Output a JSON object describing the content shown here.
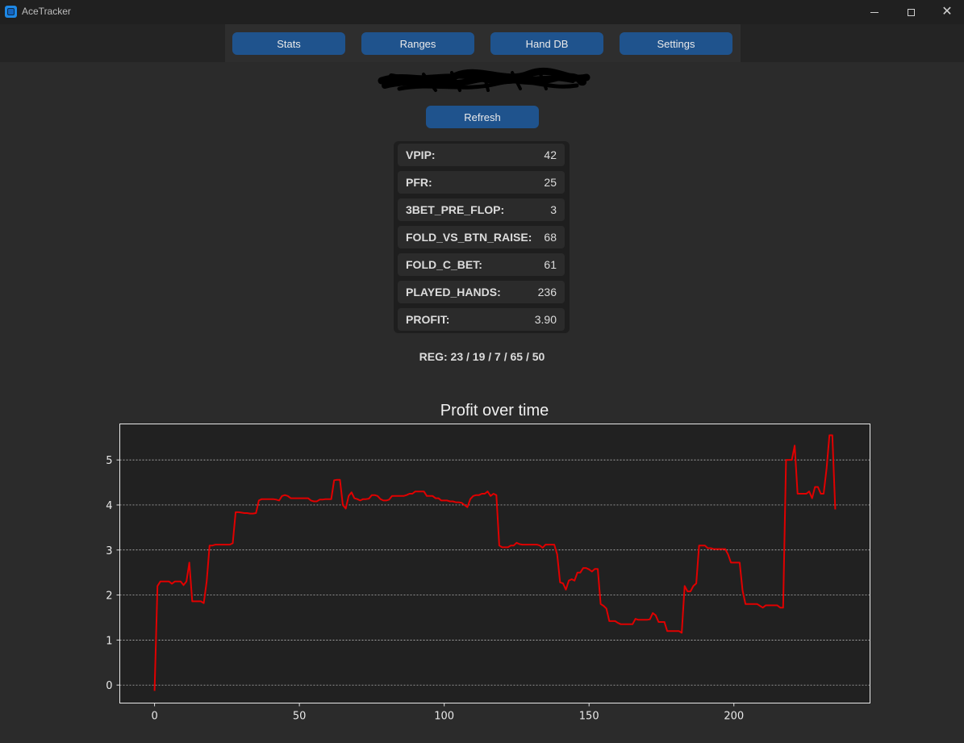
{
  "window": {
    "title": "AceTracker",
    "controls": {
      "minimize": "minimize-icon",
      "maximize": "maximize-icon",
      "close": "close-icon"
    }
  },
  "nav": {
    "buttons": [
      "Stats",
      "Ranges",
      "Hand DB",
      "Settings"
    ]
  },
  "refresh_label": "Refresh",
  "stats": [
    {
      "label": "VPIP:",
      "value": "42"
    },
    {
      "label": "PFR:",
      "value": "25"
    },
    {
      "label": "3BET_PRE_FLOP:",
      "value": "3"
    },
    {
      "label": "FOLD_VS_BTN_RAISE:",
      "value": "68"
    },
    {
      "label": "FOLD_C_BET:",
      "value": "61"
    },
    {
      "label": "PLAYED_HANDS:",
      "value": "236"
    },
    {
      "label": "PROFIT:",
      "value": "3.90"
    }
  ],
  "reg_line": "REG: 23 / 19 / 7 / 65 / 50",
  "colors": {
    "accent_button": "#1f538d",
    "background": "#2b2b2b",
    "plot_background": "#212121",
    "line": "#e00000"
  },
  "chart_data": {
    "type": "line",
    "title": "Profit over time",
    "xlabel": "",
    "ylabel": "",
    "xlim": [
      -12,
      247
    ],
    "ylim": [
      -0.4,
      5.8
    ],
    "xticks": [
      0,
      50,
      100,
      150,
      200
    ],
    "yticks": [
      0,
      1,
      2,
      3,
      4,
      5
    ],
    "grid": "horizontal dashed",
    "series": [
      {
        "x": [
          0,
          1,
          2,
          3,
          4,
          5,
          6,
          7,
          8,
          9,
          10,
          11,
          12,
          13,
          14,
          15,
          16,
          17,
          18,
          19,
          20,
          21,
          22,
          23,
          24,
          25,
          26,
          27,
          28,
          29,
          30,
          31,
          32,
          33,
          34,
          35,
          36,
          37,
          38,
          39,
          40,
          41,
          42,
          43,
          44,
          45,
          46,
          47,
          48,
          49,
          50,
          51,
          52,
          53,
          54,
          55,
          56,
          57,
          58,
          59,
          60,
          61,
          62,
          63,
          64,
          65,
          66,
          67,
          68,
          69,
          70,
          71,
          72,
          73,
          74,
          75,
          76,
          77,
          78,
          79,
          80,
          81,
          82,
          83,
          84,
          85,
          86,
          87,
          88,
          89,
          90,
          91,
          92,
          93,
          94,
          95,
          96,
          97,
          98,
          99,
          100,
          101,
          102,
          103,
          104,
          105,
          106,
          107,
          108,
          109,
          110,
          111,
          112,
          113,
          114,
          115,
          116,
          117,
          118,
          119,
          120,
          121,
          122,
          123,
          124,
          125,
          126,
          127,
          128,
          129,
          130,
          131,
          132,
          133,
          134,
          135,
          136,
          137,
          138,
          139,
          140,
          141,
          142,
          143,
          144,
          145,
          146,
          147,
          148,
          149,
          150,
          151,
          152,
          153,
          154,
          155,
          156,
          157,
          158,
          159,
          160,
          161,
          162,
          163,
          164,
          165,
          166,
          167,
          168,
          169,
          170,
          171,
          172,
          173,
          174,
          175,
          176,
          177,
          178,
          179,
          180,
          181,
          182,
          183,
          184,
          185,
          186,
          187,
          188,
          189,
          190,
          191,
          192,
          193,
          194,
          195,
          196,
          197,
          198,
          199,
          200,
          201,
          202,
          203,
          204,
          205,
          206,
          207,
          208,
          209,
          210,
          211,
          212,
          213,
          214,
          215,
          216,
          217,
          218,
          219,
          220,
          221,
          222,
          223,
          224,
          225,
          226,
          227,
          228,
          229,
          230,
          231,
          232,
          233,
          234,
          235
        ],
        "y": [
          -0.13,
          2.2,
          2.3,
          2.3,
          2.3,
          2.3,
          2.25,
          2.3,
          2.3,
          2.3,
          2.22,
          2.3,
          2.72,
          1.86,
          1.86,
          1.86,
          1.86,
          1.82,
          2.3,
          3.1,
          3.1,
          3.12,
          3.12,
          3.12,
          3.12,
          3.12,
          3.12,
          3.15,
          3.84,
          3.84,
          3.83,
          3.82,
          3.82,
          3.81,
          3.81,
          3.82,
          4.1,
          4.13,
          4.13,
          4.13,
          4.13,
          4.13,
          4.12,
          4.1,
          4.2,
          4.22,
          4.2,
          4.15,
          4.15,
          4.15,
          4.15,
          4.15,
          4.15,
          4.15,
          4.1,
          4.08,
          4.08,
          4.12,
          4.12,
          4.13,
          4.13,
          4.13,
          4.55,
          4.56,
          4.56,
          4.0,
          3.92,
          4.2,
          4.28,
          4.15,
          4.13,
          4.1,
          4.13,
          4.13,
          4.14,
          4.22,
          4.22,
          4.2,
          4.13,
          4.1,
          4.1,
          4.12,
          4.2,
          4.2,
          4.2,
          4.2,
          4.2,
          4.22,
          4.25,
          4.25,
          4.3,
          4.3,
          4.3,
          4.3,
          4.2,
          4.2,
          4.2,
          4.15,
          4.15,
          4.1,
          4.1,
          4.1,
          4.08,
          4.08,
          4.06,
          4.06,
          4.05,
          4.0,
          3.95,
          4.13,
          4.2,
          4.22,
          4.22,
          4.25,
          4.25,
          4.3,
          4.2,
          4.25,
          4.22,
          3.1,
          3.06,
          3.06,
          3.06,
          3.1,
          3.1,
          3.16,
          3.13,
          3.12,
          3.12,
          3.12,
          3.12,
          3.12,
          3.12,
          3.1,
          3.05,
          3.12,
          3.12,
          3.12,
          3.12,
          2.9,
          2.28,
          2.26,
          2.12,
          2.32,
          2.35,
          2.32,
          2.5,
          2.5,
          2.6,
          2.6,
          2.57,
          2.52,
          2.58,
          2.58,
          1.8,
          1.76,
          1.7,
          1.42,
          1.42,
          1.42,
          1.38,
          1.35,
          1.35,
          1.35,
          1.35,
          1.35,
          1.47,
          1.45,
          1.45,
          1.45,
          1.45,
          1.46,
          1.6,
          1.55,
          1.4,
          1.4,
          1.4,
          1.2,
          1.2,
          1.2,
          1.2,
          1.2,
          1.16,
          2.2,
          2.08,
          2.08,
          2.2,
          2.26,
          3.1,
          3.1,
          3.1,
          3.04,
          3.04,
          3.02,
          3.02,
          3.02,
          3.02,
          3.02,
          2.9,
          2.72,
          2.72,
          2.72,
          2.72,
          2.1,
          1.8,
          1.8,
          1.8,
          1.8,
          1.8,
          1.76,
          1.72,
          1.77,
          1.77,
          1.77,
          1.77,
          1.77,
          1.72,
          1.72,
          5.0,
          5.0,
          5.0,
          5.32,
          4.25,
          4.25,
          4.25,
          4.25,
          4.3,
          4.15,
          4.4,
          4.4,
          4.25,
          4.25,
          4.8,
          5.55,
          5.55,
          3.9
        ]
      }
    ]
  }
}
